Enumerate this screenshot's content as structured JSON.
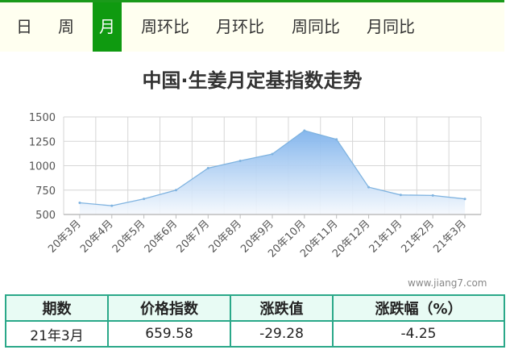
{
  "tabs": [
    {
      "label": "日",
      "active": false
    },
    {
      "label": "周",
      "active": false
    },
    {
      "label": "月",
      "active": true
    },
    {
      "label": "周环比",
      "active": false
    },
    {
      "label": "月环比",
      "active": false
    },
    {
      "label": "周同比",
      "active": false
    },
    {
      "label": "月同比",
      "active": false
    }
  ],
  "watermark": "www.jiang7.com",
  "chart_data": {
    "type": "area",
    "title": "中国·生姜月定基指数走势",
    "categories": [
      "20年3月",
      "20年4月",
      "20年5月",
      "20年6月",
      "20年7月",
      "20年8月",
      "20年9月",
      "20年10月",
      "20年11月",
      "20年12月",
      "21年1月",
      "21年2月",
      "21年3月"
    ],
    "values": [
      620,
      590,
      660,
      750,
      975,
      1050,
      1120,
      1360,
      1270,
      780,
      700,
      695,
      659.58
    ],
    "yticks": [
      500,
      750,
      1000,
      1250,
      1500
    ],
    "ylim": [
      500,
      1500
    ],
    "grid": true,
    "colors": {
      "line": "#7fb3e0",
      "fill_top": "#7fb3ec",
      "fill_bottom": "#f4f8fd",
      "grid": "#d6d6d6"
    }
  },
  "table": {
    "headers": [
      "期数",
      "价格指数",
      "涨跌值",
      "涨跌幅（%）"
    ],
    "row": [
      "21年3月",
      "659.58",
      "-29.28",
      "-4.25"
    ]
  },
  "colors": {
    "tab_active": "#0f9a10",
    "tab_bg": "#fffff0",
    "table_border": "#2aa889",
    "table_header_bg": "#e8fbf4"
  }
}
